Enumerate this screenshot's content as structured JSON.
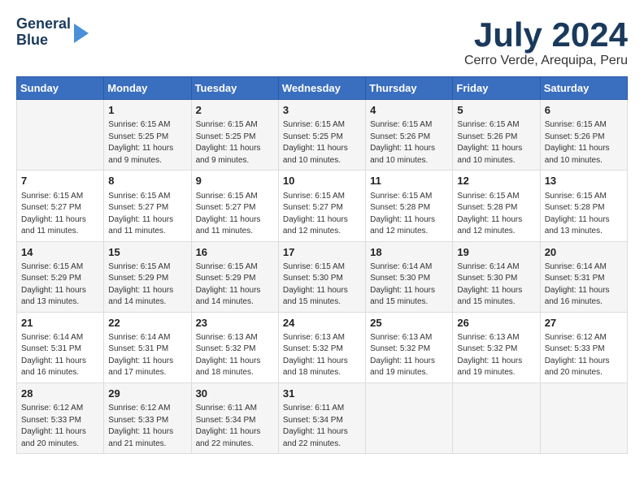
{
  "header": {
    "logo_line1": "General",
    "logo_line2": "Blue",
    "month_title": "July 2024",
    "location": "Cerro Verde, Arequipa, Peru"
  },
  "days_of_week": [
    "Sunday",
    "Monday",
    "Tuesday",
    "Wednesday",
    "Thursday",
    "Friday",
    "Saturday"
  ],
  "weeks": [
    [
      {
        "day": "",
        "info": ""
      },
      {
        "day": "1",
        "info": "Sunrise: 6:15 AM\nSunset: 5:25 PM\nDaylight: 11 hours\nand 9 minutes."
      },
      {
        "day": "2",
        "info": "Sunrise: 6:15 AM\nSunset: 5:25 PM\nDaylight: 11 hours\nand 9 minutes."
      },
      {
        "day": "3",
        "info": "Sunrise: 6:15 AM\nSunset: 5:25 PM\nDaylight: 11 hours\nand 10 minutes."
      },
      {
        "day": "4",
        "info": "Sunrise: 6:15 AM\nSunset: 5:26 PM\nDaylight: 11 hours\nand 10 minutes."
      },
      {
        "day": "5",
        "info": "Sunrise: 6:15 AM\nSunset: 5:26 PM\nDaylight: 11 hours\nand 10 minutes."
      },
      {
        "day": "6",
        "info": "Sunrise: 6:15 AM\nSunset: 5:26 PM\nDaylight: 11 hours\nand 10 minutes."
      }
    ],
    [
      {
        "day": "7",
        "info": "Sunrise: 6:15 AM\nSunset: 5:27 PM\nDaylight: 11 hours\nand 11 minutes."
      },
      {
        "day": "8",
        "info": "Sunrise: 6:15 AM\nSunset: 5:27 PM\nDaylight: 11 hours\nand 11 minutes."
      },
      {
        "day": "9",
        "info": "Sunrise: 6:15 AM\nSunset: 5:27 PM\nDaylight: 11 hours\nand 11 minutes."
      },
      {
        "day": "10",
        "info": "Sunrise: 6:15 AM\nSunset: 5:27 PM\nDaylight: 11 hours\nand 12 minutes."
      },
      {
        "day": "11",
        "info": "Sunrise: 6:15 AM\nSunset: 5:28 PM\nDaylight: 11 hours\nand 12 minutes."
      },
      {
        "day": "12",
        "info": "Sunrise: 6:15 AM\nSunset: 5:28 PM\nDaylight: 11 hours\nand 12 minutes."
      },
      {
        "day": "13",
        "info": "Sunrise: 6:15 AM\nSunset: 5:28 PM\nDaylight: 11 hours\nand 13 minutes."
      }
    ],
    [
      {
        "day": "14",
        "info": "Sunrise: 6:15 AM\nSunset: 5:29 PM\nDaylight: 11 hours\nand 13 minutes."
      },
      {
        "day": "15",
        "info": "Sunrise: 6:15 AM\nSunset: 5:29 PM\nDaylight: 11 hours\nand 14 minutes."
      },
      {
        "day": "16",
        "info": "Sunrise: 6:15 AM\nSunset: 5:29 PM\nDaylight: 11 hours\nand 14 minutes."
      },
      {
        "day": "17",
        "info": "Sunrise: 6:15 AM\nSunset: 5:30 PM\nDaylight: 11 hours\nand 15 minutes."
      },
      {
        "day": "18",
        "info": "Sunrise: 6:14 AM\nSunset: 5:30 PM\nDaylight: 11 hours\nand 15 minutes."
      },
      {
        "day": "19",
        "info": "Sunrise: 6:14 AM\nSunset: 5:30 PM\nDaylight: 11 hours\nand 15 minutes."
      },
      {
        "day": "20",
        "info": "Sunrise: 6:14 AM\nSunset: 5:31 PM\nDaylight: 11 hours\nand 16 minutes."
      }
    ],
    [
      {
        "day": "21",
        "info": "Sunrise: 6:14 AM\nSunset: 5:31 PM\nDaylight: 11 hours\nand 16 minutes."
      },
      {
        "day": "22",
        "info": "Sunrise: 6:14 AM\nSunset: 5:31 PM\nDaylight: 11 hours\nand 17 minutes."
      },
      {
        "day": "23",
        "info": "Sunrise: 6:13 AM\nSunset: 5:32 PM\nDaylight: 11 hours\nand 18 minutes."
      },
      {
        "day": "24",
        "info": "Sunrise: 6:13 AM\nSunset: 5:32 PM\nDaylight: 11 hours\nand 18 minutes."
      },
      {
        "day": "25",
        "info": "Sunrise: 6:13 AM\nSunset: 5:32 PM\nDaylight: 11 hours\nand 19 minutes."
      },
      {
        "day": "26",
        "info": "Sunrise: 6:13 AM\nSunset: 5:32 PM\nDaylight: 11 hours\nand 19 minutes."
      },
      {
        "day": "27",
        "info": "Sunrise: 6:12 AM\nSunset: 5:33 PM\nDaylight: 11 hours\nand 20 minutes."
      }
    ],
    [
      {
        "day": "28",
        "info": "Sunrise: 6:12 AM\nSunset: 5:33 PM\nDaylight: 11 hours\nand 20 minutes."
      },
      {
        "day": "29",
        "info": "Sunrise: 6:12 AM\nSunset: 5:33 PM\nDaylight: 11 hours\nand 21 minutes."
      },
      {
        "day": "30",
        "info": "Sunrise: 6:11 AM\nSunset: 5:34 PM\nDaylight: 11 hours\nand 22 minutes."
      },
      {
        "day": "31",
        "info": "Sunrise: 6:11 AM\nSunset: 5:34 PM\nDaylight: 11 hours\nand 22 minutes."
      },
      {
        "day": "",
        "info": ""
      },
      {
        "day": "",
        "info": ""
      },
      {
        "day": "",
        "info": ""
      }
    ]
  ]
}
